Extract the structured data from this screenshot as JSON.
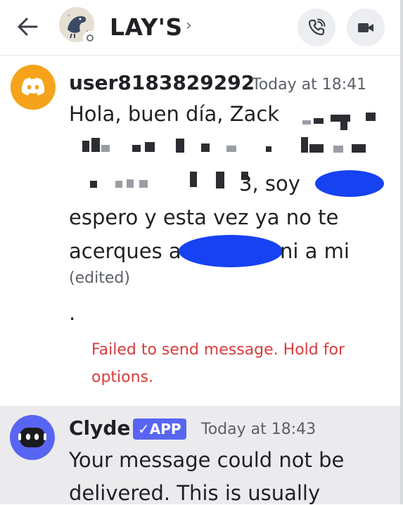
{
  "header": {
    "channel_name": "LAY'S",
    "chevron": "›",
    "back_icon": "arrow-left-icon",
    "call_icon": "phone-call-icon",
    "video_icon": "video-camera-icon"
  },
  "messages": [
    {
      "author": "user8183829292",
      "time": "Today at 18:41",
      "avatar_icon": "discord-logo-icon",
      "avatar_color": "#f6a31b",
      "line1": "Hola, buen día, Zack",
      "line3_tail": "3, soy",
      "line4": "espero y esta vez ya no te",
      "line5_start": "acerques a",
      "line5_end": "ni a mi",
      "edited": "(edited)",
      "dot": ".",
      "error": "Failed to send message. Hold for options.",
      "error_color": "#d83c3e"
    },
    {
      "author": "Clyde",
      "badge": "✓APP",
      "time": "Today at 18:43",
      "avatar_icon": "clyde-bot-icon",
      "avatar_color": "#5865f2",
      "line1": "Your message could not be",
      "line2": "delivered. This is usually"
    }
  ]
}
